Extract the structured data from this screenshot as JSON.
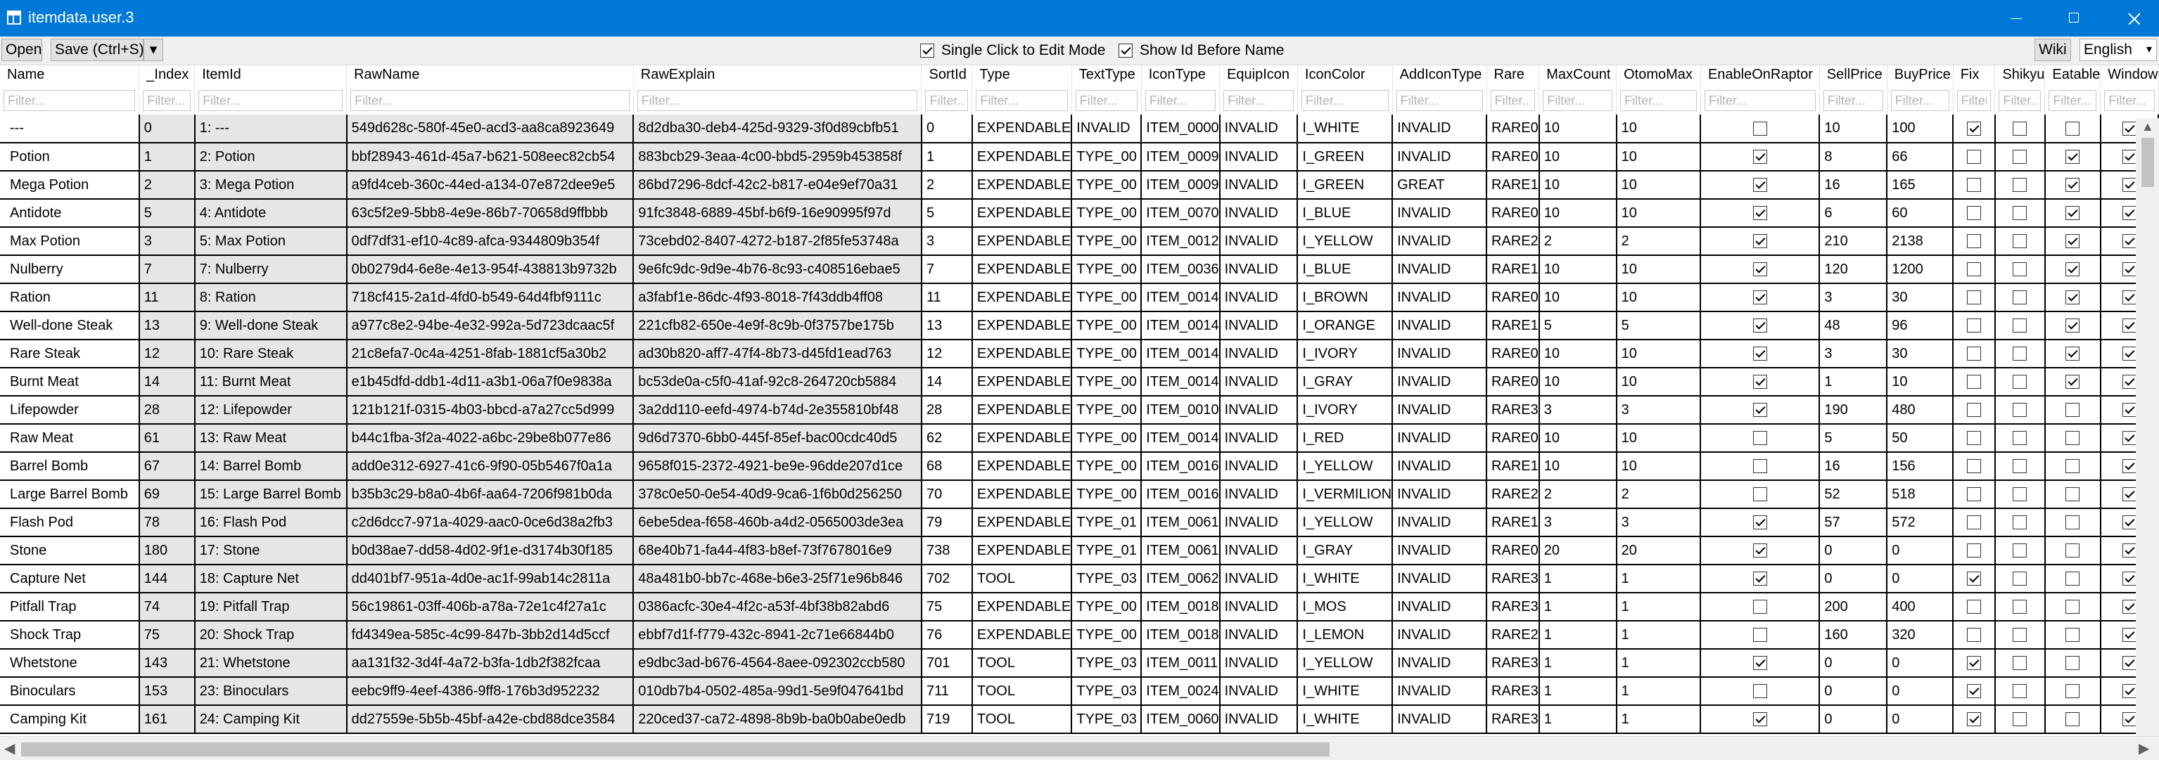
{
  "window": {
    "title": "itemdata.user.3"
  },
  "toolbar": {
    "open_label": "Open",
    "save_label": "Save (Ctrl+S)",
    "single_click_label": "Single Click to Edit Mode",
    "single_click_checked": true,
    "show_id_label": "Show Id Before Name",
    "show_id_checked": true,
    "wiki_label": "Wiki",
    "language_value": "English"
  },
  "grid": {
    "filter_placeholder": "Filter...",
    "columns": [
      {
        "key": "name",
        "label": "Name"
      },
      {
        "key": "index",
        "label": "_Index"
      },
      {
        "key": "itemid",
        "label": "ItemId"
      },
      {
        "key": "rawname",
        "label": "RawName"
      },
      {
        "key": "rawexplain",
        "label": "RawExplain"
      },
      {
        "key": "sortid",
        "label": "SortId"
      },
      {
        "key": "type",
        "label": "Type"
      },
      {
        "key": "texttype",
        "label": "TextType"
      },
      {
        "key": "icontype",
        "label": "IconType"
      },
      {
        "key": "equipicon",
        "label": "EquipIcon"
      },
      {
        "key": "iconcolor",
        "label": "IconColor"
      },
      {
        "key": "addicontype",
        "label": "AddIconType"
      },
      {
        "key": "rare",
        "label": "Rare"
      },
      {
        "key": "maxcount",
        "label": "MaxCount"
      },
      {
        "key": "otomomax",
        "label": "OtomoMax"
      },
      {
        "key": "enableonraptor",
        "label": "EnableOnRaptor"
      },
      {
        "key": "sellprice",
        "label": "SellPrice"
      },
      {
        "key": "buyprice",
        "label": "BuyPrice"
      },
      {
        "key": "fix",
        "label": "Fix"
      },
      {
        "key": "shikyu",
        "label": "Shikyu"
      },
      {
        "key": "eatable",
        "label": "Eatable"
      },
      {
        "key": "window",
        "label": "Window"
      }
    ],
    "rows": [
      [
        "---",
        "0",
        "1: ---",
        "549d628c-580f-45e0-acd3-aa8ca8923649",
        "8d2dba30-deb4-425d-9329-3f0d89cbfb51",
        "0",
        "EXPENDABLE",
        "INVALID",
        "ITEM_0000",
        "INVALID",
        "I_WHITE",
        "INVALID",
        "RARE0",
        "10",
        "10",
        false,
        "10",
        "100",
        true,
        false,
        false,
        true
      ],
      [
        "Potion",
        "1",
        "2: Potion",
        "bbf28943-461d-45a7-b621-508eec82cb54",
        "883bcb29-3eaa-4c00-bbd5-2959b453858f",
        "1",
        "EXPENDABLE",
        "TYPE_00",
        "ITEM_0009",
        "INVALID",
        "I_GREEN",
        "INVALID",
        "RARE0",
        "10",
        "10",
        true,
        "8",
        "66",
        false,
        false,
        true,
        true
      ],
      [
        "Mega Potion",
        "2",
        "3: Mega Potion",
        "a9fd4ceb-360c-44ed-a134-07e872dee9e5",
        "86bd7296-8dcf-42c2-b817-e04e9ef70a31",
        "2",
        "EXPENDABLE",
        "TYPE_00",
        "ITEM_0009",
        "INVALID",
        "I_GREEN",
        "GREAT",
        "RARE1",
        "10",
        "10",
        true,
        "16",
        "165",
        false,
        false,
        true,
        true
      ],
      [
        "Antidote",
        "5",
        "4: Antidote",
        "63c5f2e9-5bb8-4e9e-86b7-70658d9ffbbb",
        "91fc3848-6889-45bf-b6f9-16e90995f97d",
        "5",
        "EXPENDABLE",
        "TYPE_00",
        "ITEM_0070",
        "INVALID",
        "I_BLUE",
        "INVALID",
        "RARE0",
        "10",
        "10",
        true,
        "6",
        "60",
        false,
        false,
        true,
        true
      ],
      [
        "Max Potion",
        "3",
        "5: Max Potion",
        "0df7df31-ef10-4c89-afca-9344809b354f",
        "73cebd02-8407-4272-b187-2f85fe53748a",
        "3",
        "EXPENDABLE",
        "TYPE_00",
        "ITEM_0012",
        "INVALID",
        "I_YELLOW",
        "INVALID",
        "RARE2",
        "2",
        "2",
        true,
        "210",
        "2138",
        false,
        false,
        true,
        true
      ],
      [
        "Nulberry",
        "7",
        "7: Nulberry",
        "0b0279d4-6e8e-4e13-954f-438813b9732b",
        "9e6fc9dc-9d9e-4b76-8c93-c408516ebae5",
        "7",
        "EXPENDABLE",
        "TYPE_00",
        "ITEM_0036",
        "INVALID",
        "I_BLUE",
        "INVALID",
        "RARE1",
        "10",
        "10",
        true,
        "120",
        "1200",
        false,
        false,
        true,
        true
      ],
      [
        "Ration",
        "11",
        "8: Ration",
        "718cf415-2a1d-4fd0-b549-64d4fbf9111c",
        "a3fabf1e-86dc-4f93-8018-7f43ddb4ff08",
        "11",
        "EXPENDABLE",
        "TYPE_00",
        "ITEM_0014",
        "INVALID",
        "I_BROWN",
        "INVALID",
        "RARE0",
        "10",
        "10",
        true,
        "3",
        "30",
        false,
        false,
        true,
        true
      ],
      [
        "Well-done Steak",
        "13",
        "9: Well-done Steak",
        "a977c8e2-94be-4e32-992a-5d723dcaac5f",
        "221cfb82-650e-4e9f-8c9b-0f3757be175b",
        "13",
        "EXPENDABLE",
        "TYPE_00",
        "ITEM_0014",
        "INVALID",
        "I_ORANGE",
        "INVALID",
        "RARE1",
        "5",
        "5",
        true,
        "48",
        "96",
        false,
        false,
        true,
        true
      ],
      [
        "Rare Steak",
        "12",
        "10: Rare Steak",
        "21c8efa7-0c4a-4251-8fab-1881cf5a30b2",
        "ad30b820-aff7-47f4-8b73-d45fd1ead763",
        "12",
        "EXPENDABLE",
        "TYPE_00",
        "ITEM_0014",
        "INVALID",
        "I_IVORY",
        "INVALID",
        "RARE0",
        "10",
        "10",
        true,
        "3",
        "30",
        false,
        false,
        true,
        true
      ],
      [
        "Burnt Meat",
        "14",
        "11: Burnt Meat",
        "e1b45dfd-ddb1-4d11-a3b1-06a7f0e9838a",
        "bc53de0a-c5f0-41af-92c8-264720cb5884",
        "14",
        "EXPENDABLE",
        "TYPE_00",
        "ITEM_0014",
        "INVALID",
        "I_GRAY",
        "INVALID",
        "RARE0",
        "10",
        "10",
        true,
        "1",
        "10",
        false,
        false,
        true,
        true
      ],
      [
        "Lifepowder",
        "28",
        "12: Lifepowder",
        "121b121f-0315-4b03-bbcd-a7a27cc5d999",
        "3a2dd110-eefd-4974-b74d-2e355810bf48",
        "28",
        "EXPENDABLE",
        "TYPE_00",
        "ITEM_0010",
        "INVALID",
        "I_IVORY",
        "INVALID",
        "RARE3",
        "3",
        "3",
        true,
        "190",
        "480",
        false,
        false,
        false,
        true
      ],
      [
        "Raw Meat",
        "61",
        "13: Raw Meat",
        "b44c1fba-3f2a-4022-a6bc-29be8b077e86",
        "9d6d7370-6bb0-445f-85ef-bac00cdc40d5",
        "62",
        "EXPENDABLE",
        "TYPE_00",
        "ITEM_0014",
        "INVALID",
        "I_RED",
        "INVALID",
        "RARE0",
        "10",
        "10",
        false,
        "5",
        "50",
        false,
        false,
        false,
        true
      ],
      [
        "Barrel Bomb",
        "67",
        "14: Barrel Bomb",
        "add0e312-6927-41c6-9f90-05b5467f0a1a",
        "9658f015-2372-4921-be9e-96dde207d1ce",
        "68",
        "EXPENDABLE",
        "TYPE_00",
        "ITEM_0016",
        "INVALID",
        "I_YELLOW",
        "INVALID",
        "RARE1",
        "10",
        "10",
        false,
        "16",
        "156",
        false,
        false,
        false,
        true
      ],
      [
        "Large Barrel Bomb",
        "69",
        "15: Large Barrel Bomb",
        "b35b3c29-b8a0-4b6f-aa64-7206f981b0da",
        "378c0e50-0e54-40d9-9ca6-1f6b0d256250",
        "70",
        "EXPENDABLE",
        "TYPE_00",
        "ITEM_0016",
        "INVALID",
        "I_VERMILION",
        "INVALID",
        "RARE2",
        "2",
        "2",
        false,
        "52",
        "518",
        false,
        false,
        false,
        true
      ],
      [
        "Flash Pod",
        "78",
        "16: Flash Pod",
        "c2d6dcc7-971a-4029-aac0-0ce6d38a2fb3",
        "6ebe5dea-f658-460b-a4d2-0565003de3ea",
        "79",
        "EXPENDABLE",
        "TYPE_01",
        "ITEM_0061",
        "INVALID",
        "I_YELLOW",
        "INVALID",
        "RARE1",
        "3",
        "3",
        true,
        "57",
        "572",
        false,
        false,
        false,
        true
      ],
      [
        "Stone",
        "180",
        "17: Stone",
        "b0d38ae7-dd58-4d02-9f1e-d3174b30f185",
        "68e40b71-fa44-4f83-b8ef-73f7678016e9",
        "738",
        "EXPENDABLE",
        "TYPE_01",
        "ITEM_0061",
        "INVALID",
        "I_GRAY",
        "INVALID",
        "RARE0",
        "20",
        "20",
        true,
        "0",
        "0",
        false,
        false,
        false,
        true
      ],
      [
        "Capture Net",
        "144",
        "18: Capture Net",
        "dd401bf7-951a-4d0e-ac1f-99ab14c2811a",
        "48a481b0-bb7c-468e-b6e3-25f71e96b846",
        "702",
        "TOOL",
        "TYPE_03",
        "ITEM_0062",
        "INVALID",
        "I_WHITE",
        "INVALID",
        "RARE3",
        "1",
        "1",
        true,
        "0",
        "0",
        true,
        false,
        false,
        true
      ],
      [
        "Pitfall Trap",
        "74",
        "19: Pitfall Trap",
        "56c19861-03ff-406b-a78a-72e1c4f27a1c",
        "0386acfc-30e4-4f2c-a53f-4bf38b82abd6",
        "75",
        "EXPENDABLE",
        "TYPE_00",
        "ITEM_0018",
        "INVALID",
        "I_MOS",
        "INVALID",
        "RARE3",
        "1",
        "1",
        false,
        "200",
        "400",
        false,
        false,
        false,
        true
      ],
      [
        "Shock Trap",
        "75",
        "20: Shock Trap",
        "fd4349ea-585c-4c99-847b-3bb2d14d5ccf",
        "ebbf7d1f-f779-432c-8941-2c71e66844b0",
        "76",
        "EXPENDABLE",
        "TYPE_00",
        "ITEM_0018",
        "INVALID",
        "I_LEMON",
        "INVALID",
        "RARE2",
        "1",
        "1",
        false,
        "160",
        "320",
        false,
        false,
        false,
        true
      ],
      [
        "Whetstone",
        "143",
        "21: Whetstone",
        "aa131f32-3d4f-4a72-b3fa-1db2f382fcaa",
        "e9dbc3ad-b676-4564-8aee-092302ccb580",
        "701",
        "TOOL",
        "TYPE_03",
        "ITEM_0011",
        "INVALID",
        "I_YELLOW",
        "INVALID",
        "RARE3",
        "1",
        "1",
        true,
        "0",
        "0",
        true,
        false,
        false,
        true
      ],
      [
        "Binoculars",
        "153",
        "23: Binoculars",
        "eebc9ff9-4eef-4386-9ff8-176b3d952232",
        "010db7b4-0502-485a-99d1-5e9f047641bd",
        "711",
        "TOOL",
        "TYPE_03",
        "ITEM_0024",
        "INVALID",
        "I_WHITE",
        "INVALID",
        "RARE3",
        "1",
        "1",
        false,
        "0",
        "0",
        true,
        false,
        false,
        true
      ],
      [
        "Camping Kit",
        "161",
        "24: Camping Kit",
        "dd27559e-5b5b-45bf-a42e-cbd88dce3584",
        "220ced37-ca72-4898-8b9b-ba0b0abe0edb",
        "719",
        "TOOL",
        "TYPE_03",
        "ITEM_0060",
        "INVALID",
        "I_WHITE",
        "INVALID",
        "RARE3",
        "1",
        "1",
        true,
        "0",
        "0",
        true,
        false,
        false,
        true
      ]
    ]
  }
}
